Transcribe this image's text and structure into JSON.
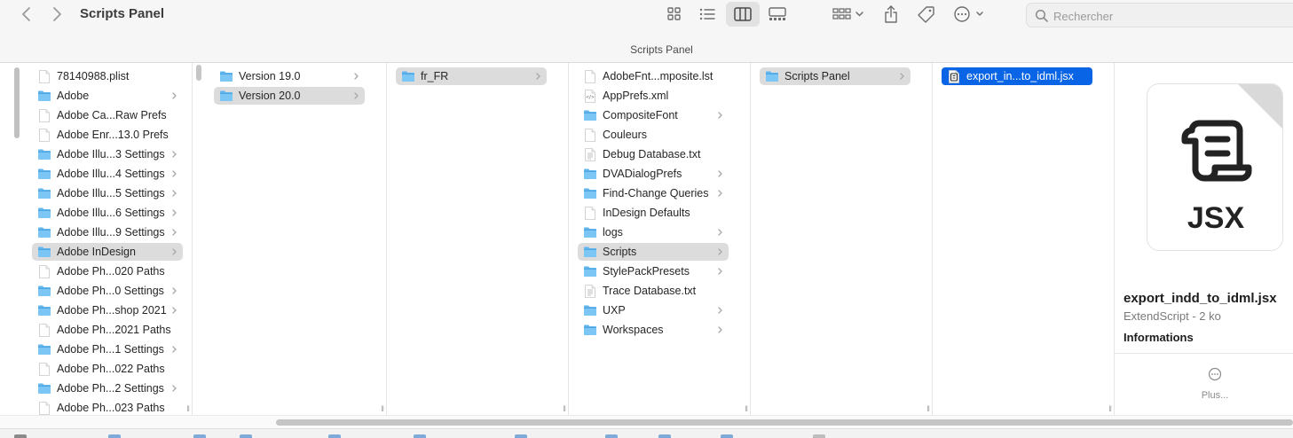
{
  "window": {
    "title": "Scripts Panel",
    "path_title": "Scripts Panel"
  },
  "toolbar": {
    "back_icon": "chevron-left-icon",
    "forward_icon": "chevron-right-icon",
    "view_modes": [
      "icon-view-icon",
      "list-view-icon",
      "column-view-icon",
      "gallery-view-icon"
    ],
    "active_view": "column-view-icon",
    "group_icon": "group-by-icon",
    "share_icon": "share-icon",
    "tag_icon": "tag-icon",
    "more_icon": "more-actions-icon"
  },
  "search": {
    "placeholder": "Rechercher",
    "value": ""
  },
  "columns": {
    "library": [
      {
        "label": "78140988.plist",
        "type": "file",
        "arrow": false
      },
      {
        "label": "Adobe",
        "type": "folder",
        "arrow": true
      },
      {
        "label": "Adobe Ca...Raw Prefs",
        "type": "file",
        "arrow": false
      },
      {
        "label": "Adobe Enr...13.0 Prefs",
        "type": "file",
        "arrow": false
      },
      {
        "label": "Adobe Illu...3 Settings",
        "type": "folder",
        "arrow": true
      },
      {
        "label": "Adobe Illu...4 Settings",
        "type": "folder",
        "arrow": true
      },
      {
        "label": "Adobe Illu...5 Settings",
        "type": "folder",
        "arrow": true
      },
      {
        "label": "Adobe Illu...6 Settings",
        "type": "folder",
        "arrow": true
      },
      {
        "label": "Adobe Illu...9 Settings",
        "type": "folder",
        "arrow": true
      },
      {
        "label": "Adobe InDesign",
        "type": "folder",
        "arrow": true,
        "selected": true
      },
      {
        "label": "Adobe Ph...020 Paths",
        "type": "file",
        "arrow": false
      },
      {
        "label": "Adobe Ph...0 Settings",
        "type": "folder",
        "arrow": true
      },
      {
        "label": "Adobe Ph...shop 2021",
        "type": "folder",
        "arrow": true
      },
      {
        "label": "Adobe Ph...2021 Paths",
        "type": "file",
        "arrow": false
      },
      {
        "label": "Adobe Ph...1 Settings",
        "type": "folder",
        "arrow": true
      },
      {
        "label": "Adobe Ph...022 Paths",
        "type": "file",
        "arrow": false
      },
      {
        "label": "Adobe Ph...2 Settings",
        "type": "folder",
        "arrow": true
      },
      {
        "label": "Adobe Ph...023 Paths",
        "type": "file",
        "arrow": false
      }
    ],
    "versions": [
      {
        "label": "Version 19.0",
        "type": "folder",
        "arrow": true
      },
      {
        "label": "Version 20.0",
        "type": "folder",
        "arrow": true,
        "selected": true
      }
    ],
    "locales": [
      {
        "label": "fr_FR",
        "type": "folder",
        "arrow": true,
        "selected": true
      }
    ],
    "indesign_prefs": [
      {
        "label": "AdobeFnt...mposite.lst",
        "type": "file",
        "arrow": false
      },
      {
        "label": "AppPrefs.xml",
        "type": "xml",
        "arrow": false
      },
      {
        "label": "CompositeFont",
        "type": "folder",
        "arrow": true
      },
      {
        "label": "Couleurs",
        "type": "file",
        "arrow": false
      },
      {
        "label": "Debug Database.txt",
        "type": "txt",
        "arrow": false
      },
      {
        "label": "DVADialogPrefs",
        "type": "folder",
        "arrow": true
      },
      {
        "label": "Find-Change Queries",
        "type": "folder",
        "arrow": true
      },
      {
        "label": "InDesign Defaults",
        "type": "file",
        "arrow": false
      },
      {
        "label": "logs",
        "type": "folder",
        "arrow": true
      },
      {
        "label": "Scripts",
        "type": "folder",
        "arrow": true,
        "selected": true
      },
      {
        "label": "StylePackPresets",
        "type": "folder",
        "arrow": true
      },
      {
        "label": "Trace Database.txt",
        "type": "txt",
        "arrow": false
      },
      {
        "label": "UXP",
        "type": "folder",
        "arrow": true
      },
      {
        "label": "Workspaces",
        "type": "folder",
        "arrow": true
      }
    ],
    "scripts": [
      {
        "label": "Scripts Panel",
        "type": "folder",
        "arrow": true,
        "selected": true
      }
    ],
    "scripts_panel": [
      {
        "label": "export_in...to_idml.jsx",
        "type": "jsx",
        "arrow": false,
        "selected_blue": true
      }
    ]
  },
  "preview": {
    "icon_text": "JSX",
    "file_name": "export_indd_to_idml.jsx",
    "kind_size": "ExtendScript - 2 ko",
    "info_heading": "Informations",
    "more_label": "Plus..."
  },
  "colors": {
    "folder": "#5fb5ee",
    "selection_blue": "#0a64e6",
    "selection_gray": "#dcdcdc"
  }
}
